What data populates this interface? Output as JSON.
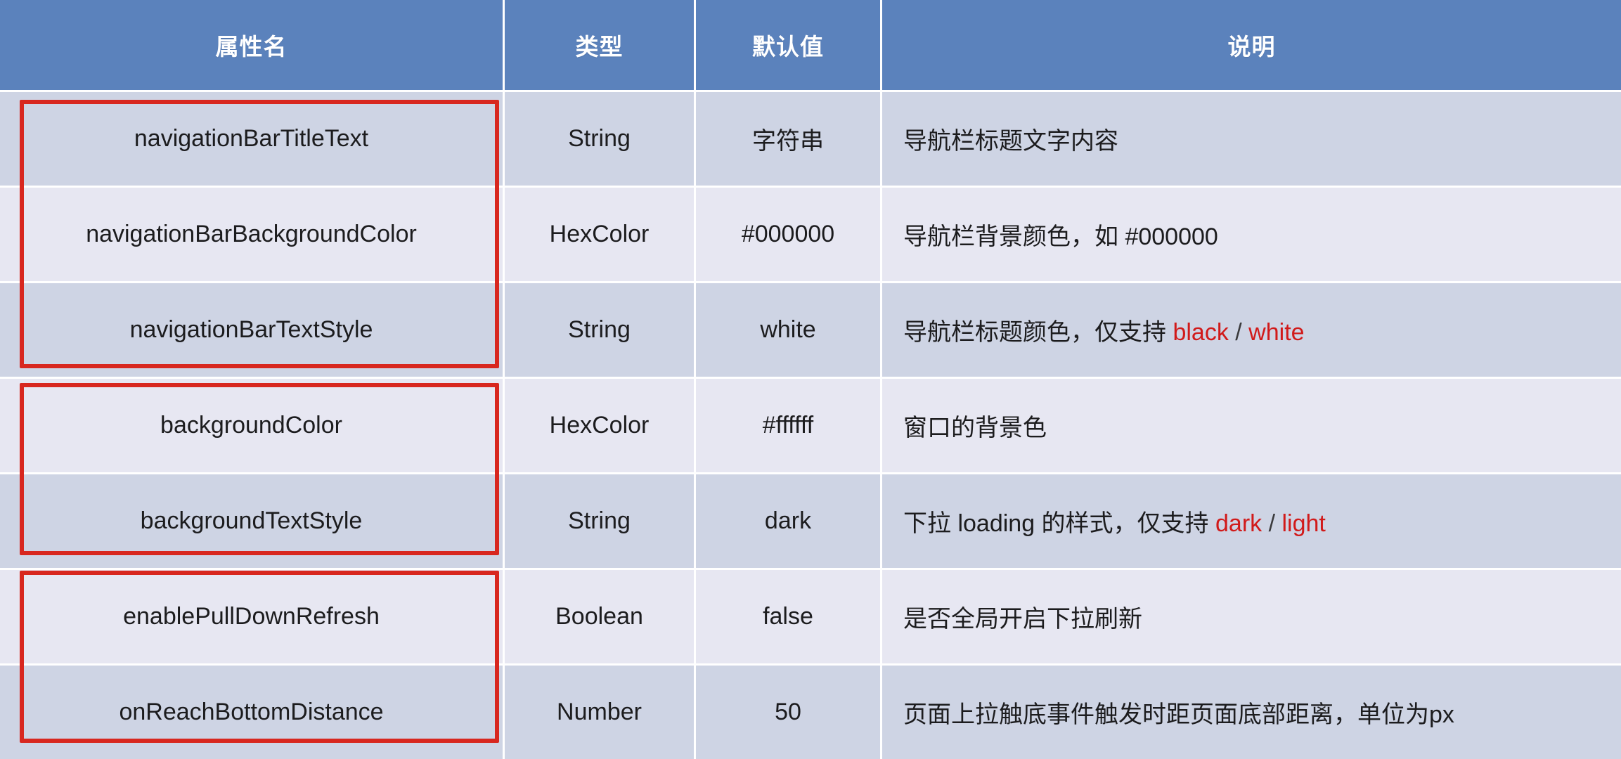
{
  "table": {
    "columns": [
      {
        "key": "name",
        "label": "属性名"
      },
      {
        "key": "type",
        "label": "类型"
      },
      {
        "key": "default",
        "label": "默认值"
      },
      {
        "key": "desc",
        "label": "说明"
      }
    ],
    "rows": [
      {
        "name": "navigationBarTitleText",
        "type": "String",
        "default": "字符串",
        "desc_prefix": "导航栏标题文字内容",
        "desc_value_a": "",
        "desc_sep": "",
        "desc_value_b": ""
      },
      {
        "name": "navigationBarBackgroundColor",
        "type": "HexColor",
        "default": "#000000",
        "desc_prefix": "导航栏背景颜色，如 #000000",
        "desc_value_a": "",
        "desc_sep": "",
        "desc_value_b": ""
      },
      {
        "name": "navigationBarTextStyle",
        "type": "String",
        "default": "white",
        "desc_prefix": "导航栏标题颜色，仅支持 ",
        "desc_value_a": "black",
        "desc_sep": " / ",
        "desc_value_b": "white"
      },
      {
        "name": "backgroundColor",
        "type": "HexColor",
        "default": "#ffffff",
        "desc_prefix": "窗口的背景色",
        "desc_value_a": "",
        "desc_sep": "",
        "desc_value_b": ""
      },
      {
        "name": "backgroundTextStyle",
        "type": "String",
        "default": "dark",
        "desc_prefix": "下拉 loading 的样式，仅支持 ",
        "desc_value_a": "dark",
        "desc_sep": " / ",
        "desc_value_b": "light"
      },
      {
        "name": "enablePullDownRefresh",
        "type": "Boolean",
        "default": "false",
        "desc_prefix": "是否全局开启下拉刷新",
        "desc_value_a": "",
        "desc_sep": "",
        "desc_value_b": ""
      },
      {
        "name": "onReachBottomDistance",
        "type": "Number",
        "default": "50",
        "desc_prefix": "页面上拉触底事件触发时距页面底部距离，单位为px",
        "desc_value_a": "",
        "desc_sep": "",
        "desc_value_b": ""
      }
    ]
  },
  "annotations": {
    "color": "#d8271f",
    "boxes": [
      {
        "label": "navigation-bar-group",
        "rows": "1-3"
      },
      {
        "label": "background-group",
        "rows": "4-5"
      },
      {
        "label": "pull-refresh-group",
        "rows": "6-7"
      }
    ]
  },
  "colors": {
    "header_bg": "#5b82bc",
    "header_text": "#ffffff",
    "row_dark": "#ced4e4",
    "row_light": "#e7e7f2",
    "accent_red": "#d11a1a",
    "annotation_red": "#d8271f",
    "body_text": "#1c1c1e"
  }
}
